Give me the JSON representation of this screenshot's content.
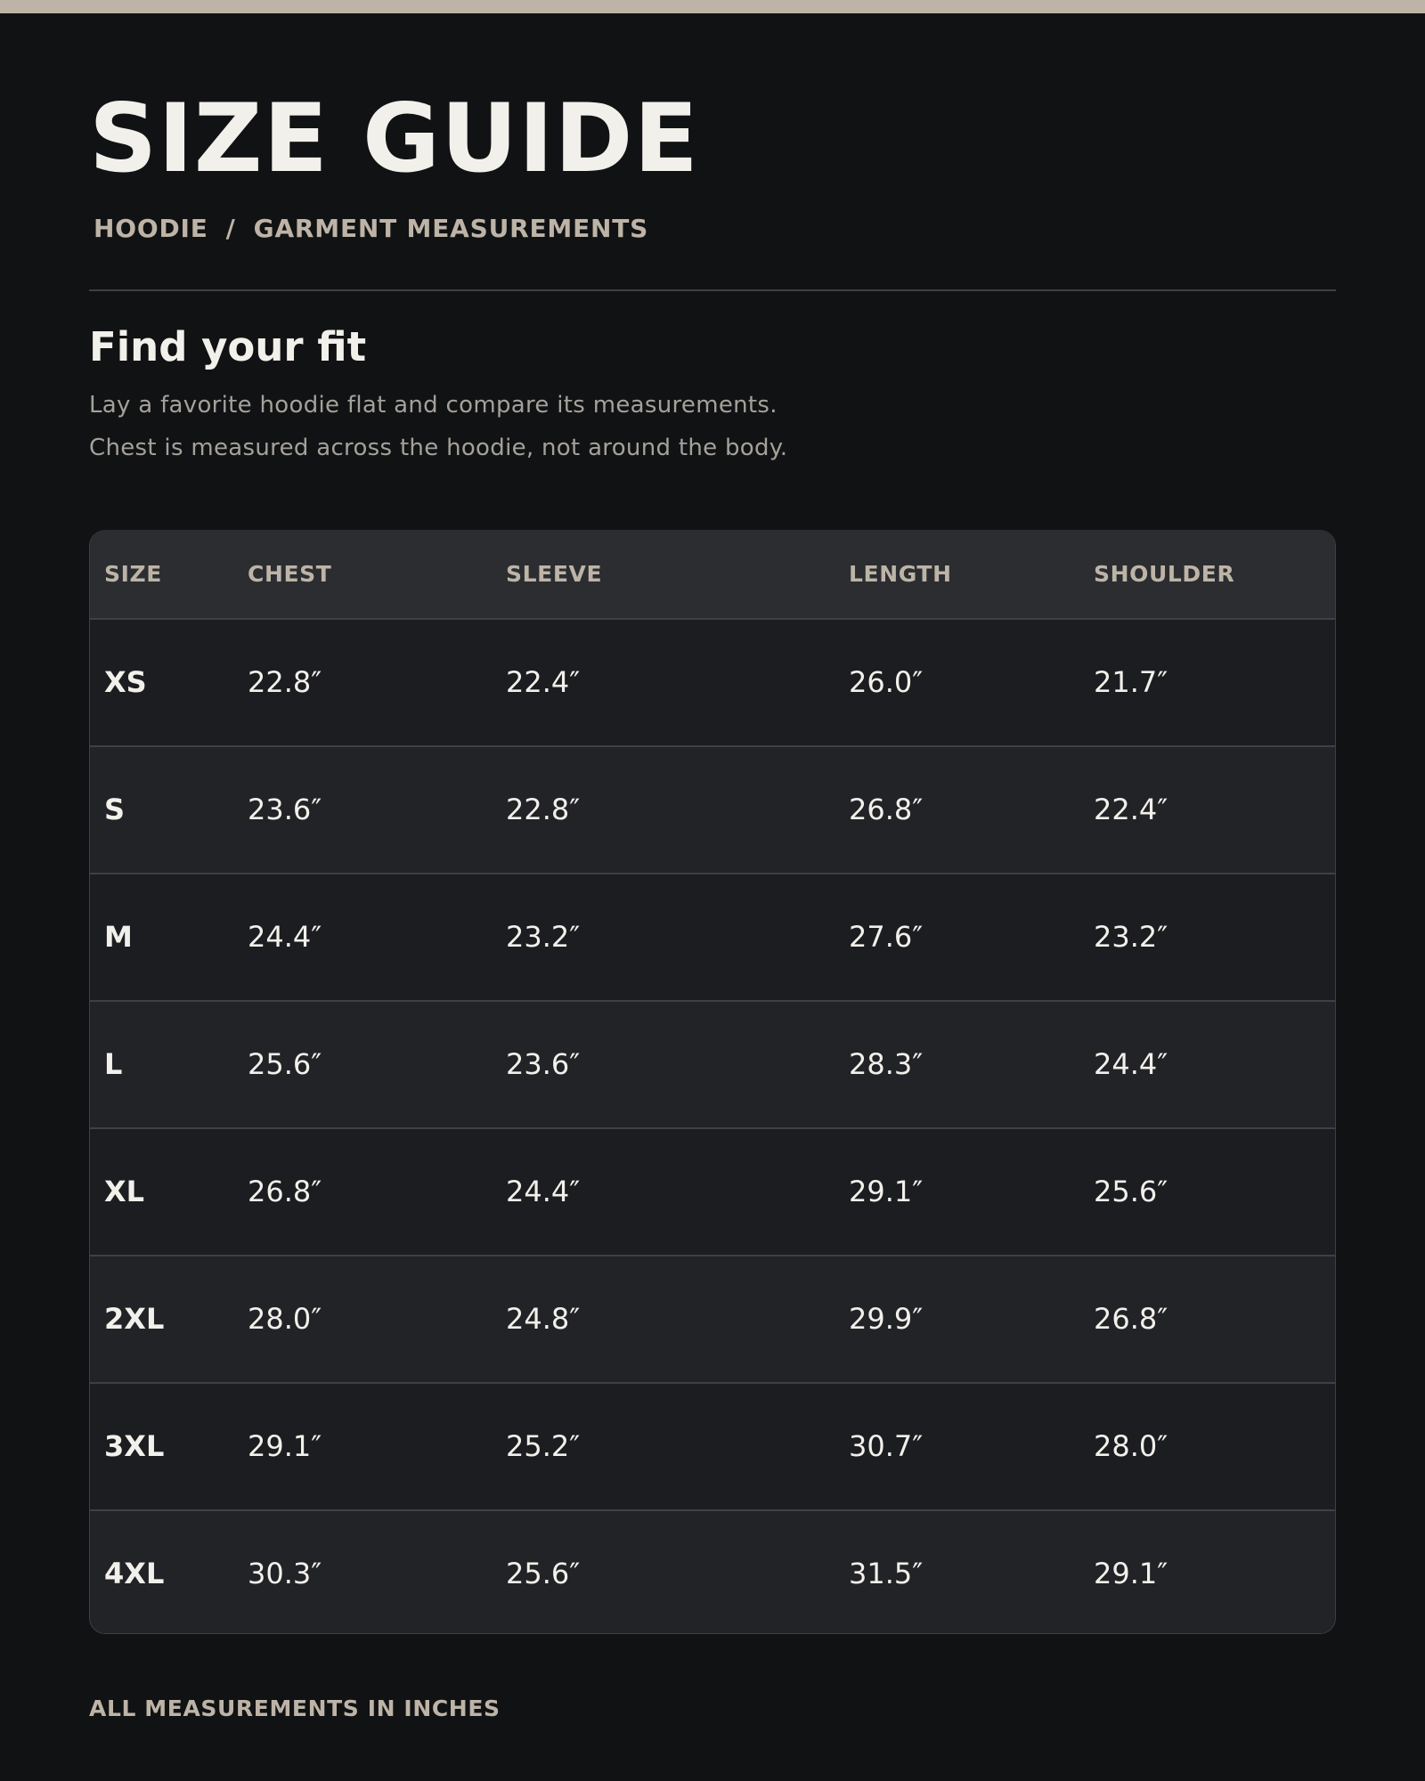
{
  "page": {
    "title": "SIZE GUIDE",
    "breadcrumb": {
      "product": "HOODIE",
      "separator": "/",
      "section": "GARMENT MEASUREMENTS"
    },
    "fit_heading": "Find your fit",
    "fit_description": [
      "Lay a favorite hoodie flat and compare its measurements.",
      "Chest is measured across the hoodie, not around the body."
    ],
    "footer_note": "ALL MEASUREMENTS IN INCHES"
  },
  "table": {
    "headers": [
      "SIZE",
      "CHEST",
      "SLEEVE",
      "LENGTH",
      "SHOULDER"
    ],
    "rows": [
      [
        "XS",
        "22.8″",
        "22.4″",
        "26.0″",
        "21.7″"
      ],
      [
        "S",
        "23.6″",
        "22.8″",
        "26.8″",
        "22.4″"
      ],
      [
        "M",
        "24.4″",
        "23.2″",
        "27.6″",
        "23.2″"
      ],
      [
        "L",
        "25.6″",
        "23.6″",
        "28.3″",
        "24.4″"
      ],
      [
        "XL",
        "26.8″",
        "24.4″",
        "29.1″",
        "25.6″"
      ],
      [
        "2XL",
        "28.0″",
        "24.8″",
        "29.9″",
        "26.8″"
      ],
      [
        "3XL",
        "29.1″",
        "25.2″",
        "30.7″",
        "28.0″"
      ],
      [
        "4XL",
        "30.3″",
        "25.6″",
        "31.5″",
        "29.1″"
      ]
    ]
  },
  "colors": {
    "background": "#111214",
    "accent": "#bdb4a7",
    "text": "#f2f0ea",
    "muted_text": "#a4a19a",
    "table_header": "#2c2d31",
    "row_odd": "#1c1d20",
    "row_even": "#222327"
  }
}
